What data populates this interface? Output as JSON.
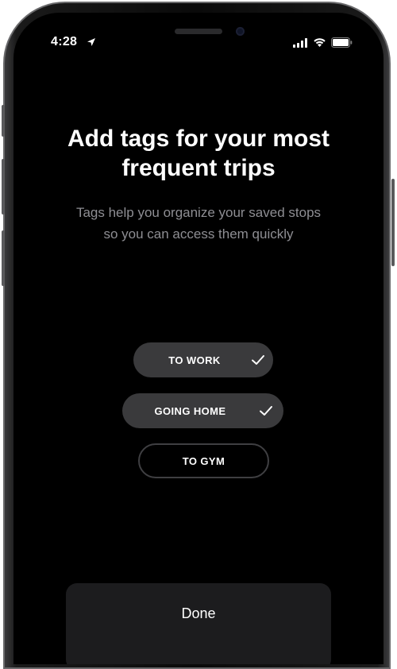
{
  "status_bar": {
    "time": "4:28",
    "location_icon": "location-arrow-icon",
    "signal_icon": "cellular-signal-icon",
    "wifi_icon": "wifi-icon",
    "battery_icon": "battery-icon"
  },
  "onboarding": {
    "title": "Add tags for your most\nfrequent trips",
    "subtitle": "Tags help you organize your saved stops\nso you can access them quickly"
  },
  "tags": [
    {
      "label": "TO WORK",
      "selected": true
    },
    {
      "label": "GOING HOME",
      "selected": true
    },
    {
      "label": "TO GYM",
      "selected": false
    }
  ],
  "done_label": "Done",
  "colors": {
    "background": "#000000",
    "text_primary": "#ffffff",
    "text_secondary": "#8e8e93",
    "tag_selected": "#3a3a3c",
    "tag_unselected_border": "#3f3f42",
    "button": "#1c1c1e"
  }
}
